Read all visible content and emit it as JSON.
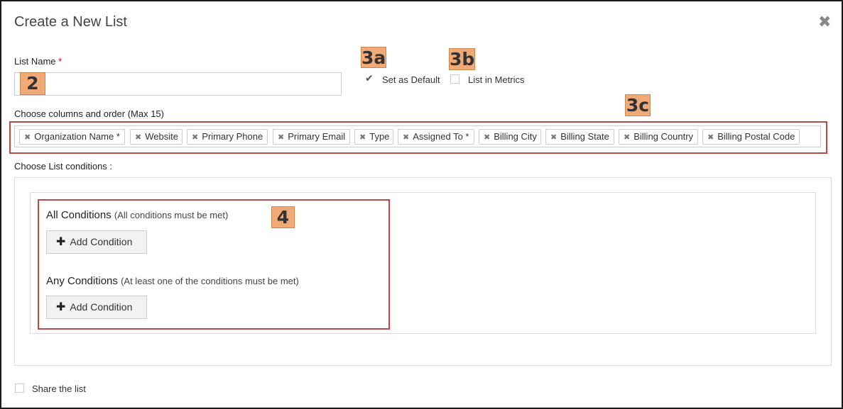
{
  "dialog": {
    "title": "Create a New List",
    "close_icon": "close-icon"
  },
  "list_name": {
    "label": "List Name",
    "required_marker": "*",
    "value": "",
    "callout": "2"
  },
  "options": {
    "set_default": {
      "label": "Set as Default",
      "checked": true,
      "callout": "3a"
    },
    "list_in_metrics": {
      "label": "List in Metrics",
      "checked": false,
      "callout": "3b"
    }
  },
  "columns": {
    "label": "Choose columns and order (Max 15)",
    "callout": "3c",
    "tags": [
      "Organization Name *",
      "Website",
      "Primary Phone",
      "Primary Email",
      "Type",
      "Assigned To *",
      "Billing City",
      "Billing State",
      "Billing Country",
      "Billing Postal Code"
    ]
  },
  "conditions": {
    "label": "Choose List conditions :",
    "callout": "4",
    "all": {
      "title": "All Conditions",
      "subtitle": "(All conditions must be met)",
      "button": "Add Condition"
    },
    "any": {
      "title": "Any Conditions",
      "subtitle": "(At least one of the conditions must be met)",
      "button": "Add Condition"
    }
  },
  "share": {
    "label": "Share the list",
    "checked": false
  }
}
